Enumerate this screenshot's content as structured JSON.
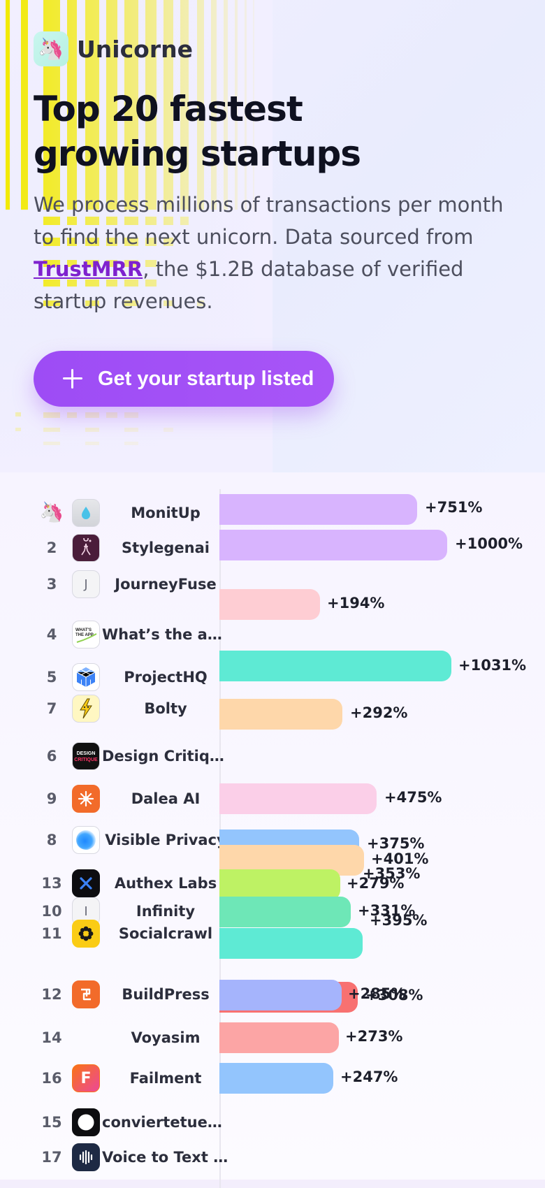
{
  "brand": {
    "name": "Unicorne",
    "logo_icon": "unicorn-icon"
  },
  "hero": {
    "title": "Top 20 fastest growing startups",
    "lead_before": "We process millions of transactions per month to find the next unicorn. Data sourced from ",
    "lead_link": "TrustMRR",
    "lead_after": ", the $1.2B database of verified startup revenues.",
    "cta_label": "Get your startup listed"
  },
  "colors": {
    "accent": "#a855f7",
    "link": "#7e22ce"
  },
  "leaderboard": [
    {
      "rank": "",
      "rank_icon": "unicorn-icon",
      "name": "MonitUp",
      "logo": "drop-icon",
      "growth": "+751%",
      "color": "#d8b4fe"
    },
    {
      "rank": "2",
      "name": "Stylegenai",
      "logo": "figure-icon",
      "growth": "+1000%",
      "color": "#d8b4fe"
    },
    {
      "rank": "3",
      "name": "JourneyFuse",
      "logo": "letter-j-icon",
      "logo_text": "J",
      "growth": "",
      "color": ""
    },
    {
      "rank": "",
      "name": "",
      "logo": "",
      "growth": "+194%",
      "color": "#fecdd3"
    },
    {
      "rank": "4",
      "name": "What’s the app …",
      "logo": "whats-the-app-icon",
      "growth": "",
      "color": ""
    },
    {
      "rank": "5",
      "name": "ProjectHQ",
      "logo": "hex-cube-icon",
      "growth": "+1031%",
      "color": "#5eead4"
    },
    {
      "rank": "7",
      "name": "Bolty",
      "logo": "bolt-mascot-icon",
      "growth": "+292%",
      "color": "#fed7aa"
    },
    {
      "rank": "6",
      "name": "Design Critique",
      "logo": "design-critique-icon",
      "growth": "",
      "color": ""
    },
    {
      "rank": "9",
      "name": "Dalea AI",
      "logo": "dalea-icon",
      "growth": "+475%",
      "color": "#fbcfe8"
    },
    {
      "rank": "8",
      "name": "Visible Privacy",
      "logo": "blue-orb-icon",
      "growth": "+375%",
      "color": "#93c5fd"
    },
    {
      "rank": "",
      "name": "",
      "logo": "",
      "growth": "+401%",
      "color": "#fed7aa"
    },
    {
      "rank": "",
      "name": "",
      "logo": "",
      "growth": "+353%",
      "color": "#fed7aa"
    },
    {
      "rank": "13",
      "name": "Authex Labs",
      "logo": "x-icon",
      "growth": "+279%",
      "color": "#bef264"
    },
    {
      "rank": "10",
      "name": "Infinity",
      "logo": "letter-i-icon",
      "logo_text": "I",
      "growth": "+331%",
      "color": "#6ee7b7"
    },
    {
      "rank": "11",
      "name": "Socialcrawl",
      "logo": "flower-icon",
      "growth": "+395%",
      "color": "#5eead4"
    },
    {
      "rank": "12",
      "name": "BuildPress",
      "logo": "buildpress-icon",
      "growth": "+285%",
      "color": "#a5b4fc"
    },
    {
      "rank": "",
      "name": "",
      "logo": "",
      "growth": "+308%",
      "color": "#f87171"
    },
    {
      "rank": "14",
      "name": "Voyasim",
      "logo": "",
      "growth": "+273%",
      "color": "#fca5a5"
    },
    {
      "rank": "16",
      "name": "Failment",
      "logo": "letter-f-icon",
      "logo_text": "F",
      "growth": "+247%",
      "color": "#93c5fd"
    },
    {
      "rank": "15",
      "name": "conviertetuesta…",
      "logo": "ring-icon",
      "growth": "",
      "color": ""
    },
    {
      "rank": "17",
      "name": "Voice to Text O…",
      "logo": "soundwave-icon",
      "growth": "",
      "color": ""
    }
  ]
}
